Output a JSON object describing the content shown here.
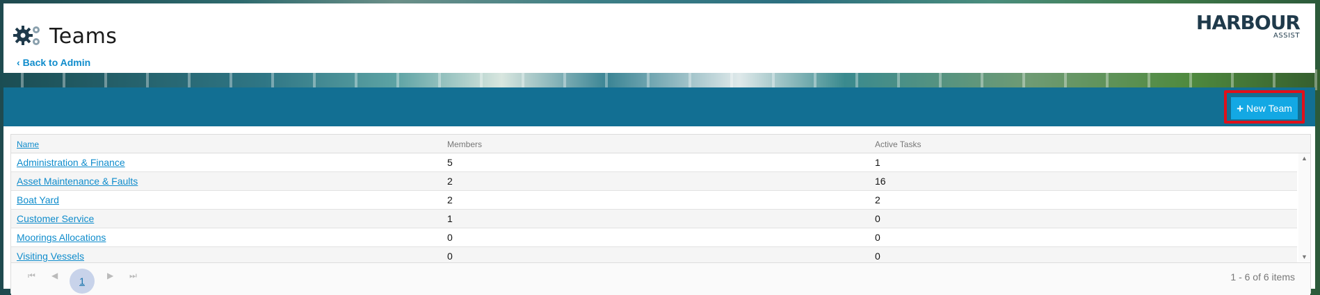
{
  "header": {
    "title": "Teams",
    "back_label": "Back to Admin",
    "logo_main": "HARBOUR",
    "logo_sub": "ASSIST"
  },
  "toolbar": {
    "new_team_label": "New Team",
    "new_team_icon": "plus-icon",
    "toolbar_color": "#126f93",
    "button_color": "#13a8e4",
    "highlight_color": "#e0101a"
  },
  "grid": {
    "columns": [
      "Name",
      "Members",
      "Active Tasks"
    ],
    "rows": [
      {
        "name": "Administration & Finance",
        "members": "5",
        "tasks": "1"
      },
      {
        "name": "Asset Maintenance & Faults",
        "members": "2",
        "tasks": "16"
      },
      {
        "name": "Boat Yard",
        "members": "2",
        "tasks": "2"
      },
      {
        "name": "Customer Service",
        "members": "1",
        "tasks": "0"
      },
      {
        "name": "Moorings Allocations",
        "members": "0",
        "tasks": "0"
      },
      {
        "name": "Visiting Vessels",
        "members": "0",
        "tasks": "0"
      }
    ]
  },
  "pager": {
    "current_page": "1",
    "info": "1 - 6 of 6 items",
    "first_icon": "first-page-icon",
    "prev_icon": "prev-page-icon",
    "next_icon": "next-page-icon",
    "last_icon": "last-page-icon"
  }
}
